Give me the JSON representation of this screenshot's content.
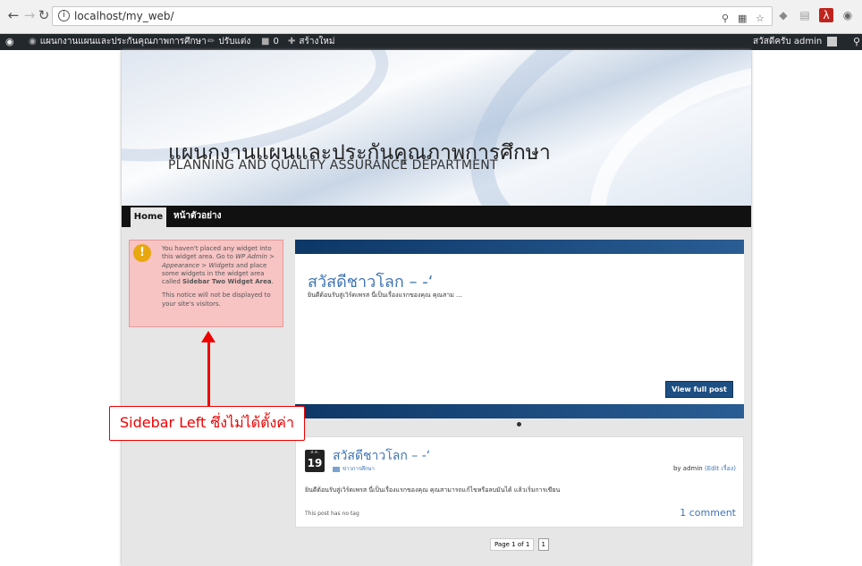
{
  "browser": {
    "back_icon": "back-arrow-icon",
    "forward_icon": "forward-arrow-icon",
    "reload_icon": "reload-icon",
    "url": "localhost/my_web/",
    "address_icons": [
      "zoom-icon",
      "translate-icon",
      "star-icon"
    ],
    "extension_icons": [
      "extension-icon",
      "bookmark-icon",
      "pdf-icon",
      "camera-icon"
    ]
  },
  "admin_bar": {
    "site_name": "แผนกงานแผนและประกันคุณภาพการศึกษา",
    "customize": "ปรับแต่ง",
    "comments_count": "0",
    "new": "สร้างใหม่",
    "greeting": "สวัสดีครับ admin"
  },
  "header": {
    "title": "แผนกงานแผนและประกันคุณภาพการศึกษา",
    "description": "PLANNING AND QUALITY ASSURANCE DEPARTMENT"
  },
  "nav": {
    "items": [
      {
        "label": "Home"
      },
      {
        "label": "หน้าตัวอย่าง"
      }
    ]
  },
  "sidebar_notice": {
    "line1_pre": "You haven't placed any widget into this widget area. Go to ",
    "wp_admin": "WP Admin",
    "sep1": " > ",
    "appearance": "Appearance",
    "sep2": " > ",
    "widgets": "Widgets",
    "line1_mid": " and place some widgets in the widget area called ",
    "area_name": "Sidebar Two Widget Area",
    "line1_end": ".",
    "line2": "This notice will not be displayed to your site's visitors."
  },
  "slider": {
    "title": "สวัสดีชาวโลก – -‘",
    "excerpt": "ยินดีต้อนรับสู่เวิร์ดเพรส นี่เป็นเรื่องแรกของคุณ คุณสาม ...",
    "button": "View full post"
  },
  "post": {
    "month": "ส.ค.",
    "day": "19",
    "title": "สวัสดีชาวโลก – -‘",
    "category": "ข่าวการศึกษา",
    "by": "by admin",
    "edit": "(Edit เรื่อง)",
    "excerpt": "ยินดีต้อนรับสู่เวิร์ดเพรส นี่เป็นเรื่องแรกของคุณ คุณสามารถแก้ไขหรือลบมันได้ แล้วเริ่มการเขียน",
    "tags": "This post has no tag",
    "comments": "1 comment"
  },
  "pagination": {
    "info": "Page 1 of 1",
    "current": "1"
  },
  "annotation": {
    "label": "Sidebar Left ซึ่งไม่ได้ตั้งค่า"
  },
  "colors": {
    "admin_bar": "#23282d",
    "link_blue": "#3f74b3",
    "slider_bar": "#0d3766",
    "notice_bg": "#f7c3c3",
    "annotation_red": "#e00000"
  }
}
